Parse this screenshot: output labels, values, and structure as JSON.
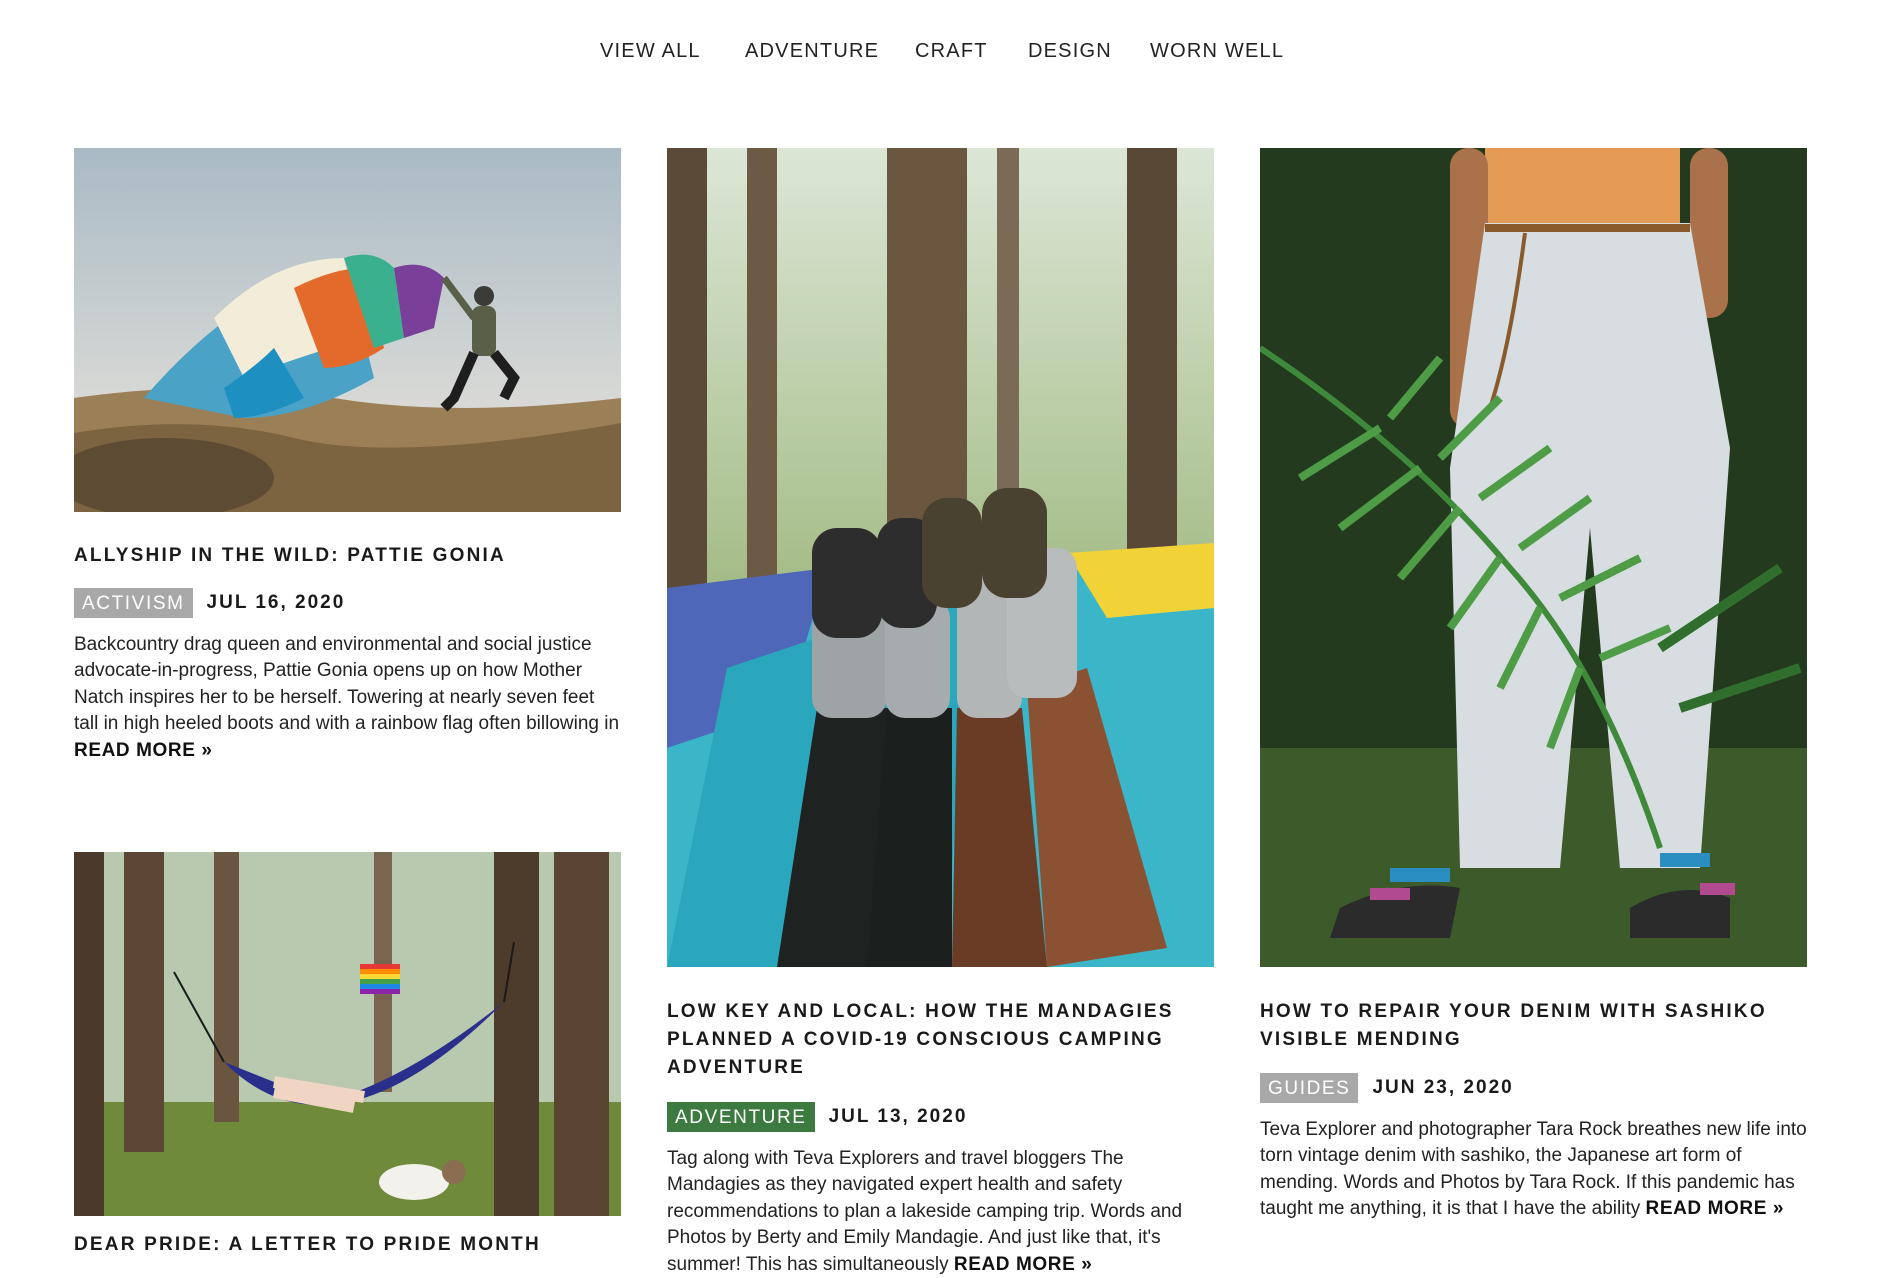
{
  "nav": {
    "items": [
      "VIEW ALL",
      "ADVENTURE",
      "CRAFT",
      "DESIGN",
      "WORN WELL"
    ]
  },
  "posts": [
    {
      "title": "ALLYSHIP IN THE WILD: PATTIE GONIA",
      "tag": "ACTIVISM",
      "date": "JUL 16, 2020",
      "excerpt": "Backcountry drag queen and environmental and social justice advocate-in-progress, Pattie Gonia opens up on how Mother Natch inspires her to be herself.  Towering at nearly seven feet tall in high heeled boots and with a rainbow flag often billowing in",
      "read_more": "READ MORE »"
    },
    {
      "title": "LOW KEY AND LOCAL: HOW THE MANDAGIES PLANNED A COVID-19 CONSCIOUS CAMPING ADVENTURE",
      "tag": "ADVENTURE",
      "date": "JUL 13, 2020",
      "excerpt": "Tag along with Teva Explorers and travel bloggers The Mandagies as they navigated expert health and safety recommendations to plan a lakeside camping trip. Words and Photos by Berty and Emily Mandagie. And just like that, it's summer! This has simultaneously",
      "read_more": "READ MORE »"
    },
    {
      "title": "HOW TO REPAIR YOUR DENIM WITH SASHIKO VISIBLE MENDING",
      "tag": "GUIDES",
      "date": "JUN 23, 2020",
      "excerpt": "Teva Explorer and photographer Tara Rock breathes new life into torn vintage denim with sashiko, the Japanese art form of mending. Words and Photos by Tara Rock.  If this pandemic has taught me anything, it is that I have the ability",
      "read_more": "READ MORE »"
    },
    {
      "title": "DEAR PRIDE: A LETTER TO PRIDE MONTH"
    }
  ],
  "colors": {
    "tag_gray": "#a8a8a8",
    "tag_green": "#3c7a3f"
  }
}
